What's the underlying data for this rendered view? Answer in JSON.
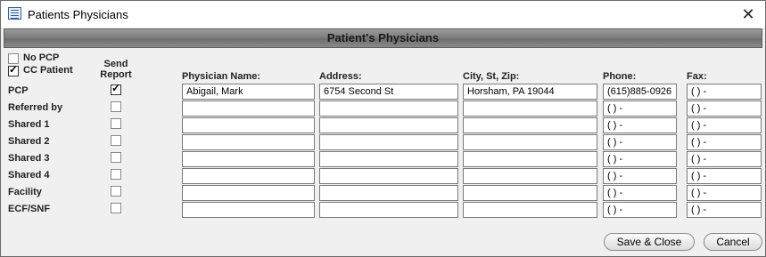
{
  "window": {
    "title": "Patients Physicians",
    "close_glyph": "✕",
    "header": "Patient's Physicians"
  },
  "flags": {
    "no_pcp": {
      "label": "No PCP",
      "checked": false
    },
    "cc_patient": {
      "label": "CC Patient",
      "checked": true
    }
  },
  "columns": {
    "send_report": "Send Report",
    "physician_name": "Physician Name:",
    "address": "Address:",
    "city_st_zip": "City, St, Zip:",
    "phone": "Phone:",
    "fax": "Fax:"
  },
  "rows": [
    {
      "label": "PCP",
      "send_report": true,
      "name": "Abigail, Mark",
      "address": "6754 Second St",
      "city": "Horsham, PA 19044",
      "phone": "(615)885-0926",
      "fax": "(  )   -"
    },
    {
      "label": "Referred by",
      "send_report": false,
      "name": "",
      "address": "",
      "city": "",
      "phone": "(  )   -",
      "fax": "(  )   -"
    },
    {
      "label": "Shared 1",
      "send_report": false,
      "name": "",
      "address": "",
      "city": "",
      "phone": "(  )   -",
      "fax": "(  )   -"
    },
    {
      "label": "Shared 2",
      "send_report": false,
      "name": "",
      "address": "",
      "city": "",
      "phone": "(  )   -",
      "fax": "(  )   -"
    },
    {
      "label": "Shared 3",
      "send_report": false,
      "name": "",
      "address": "",
      "city": "",
      "phone": "(  )   -",
      "fax": "(  )   -"
    },
    {
      "label": "Shared 4",
      "send_report": false,
      "name": "",
      "address": "",
      "city": "",
      "phone": "(  )   -",
      "fax": "(  )   -"
    },
    {
      "label": "Facility",
      "send_report": false,
      "name": "",
      "address": "",
      "city": "",
      "phone": "(  )   -",
      "fax": "(  )   -"
    },
    {
      "label": "ECF/SNF",
      "send_report": false,
      "name": "",
      "address": "",
      "city": "",
      "phone": "(  )   -",
      "fax": "(  )   -"
    }
  ],
  "buttons": {
    "save_close": "Save & Close",
    "cancel": "Cancel"
  }
}
